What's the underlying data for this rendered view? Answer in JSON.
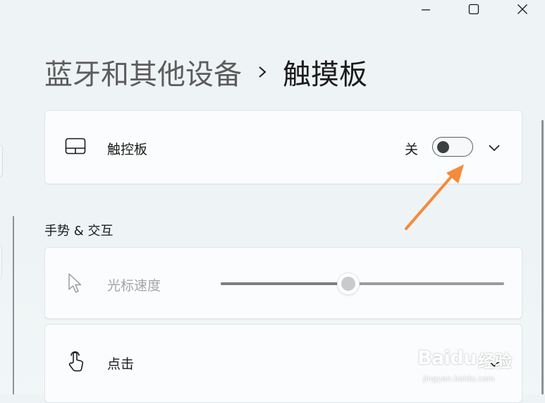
{
  "window": {
    "controls": [
      "minimize-icon",
      "maximize-icon",
      "close-icon"
    ]
  },
  "breadcrumb": {
    "parent": "蓝牙和其他设备",
    "separator_icon": "chevron-right-icon",
    "current": "触摸板"
  },
  "touchpad_card": {
    "icon": "touchpad-icon",
    "label": "触控板",
    "toggle_state_label": "关",
    "toggle_on": false,
    "expand_icon": "chevron-down-icon"
  },
  "gestures_section": {
    "header": "手势 & 交互",
    "cursor_speed": {
      "icon": "pointer-icon",
      "label": "光标速度",
      "value_fraction": 0.45,
      "disabled": true
    },
    "tap": {
      "icon": "tap-hand-icon",
      "label": "点击",
      "expand_icon": "chevron-down-icon"
    }
  },
  "annotation": {
    "arrow_color": "#f58a3a"
  },
  "watermark": {
    "brand": "Baidu",
    "jingyan": "经验",
    "url": "jingyan.baidu.com"
  },
  "colors": {
    "background": "#eef4f6",
    "card": "#fafcfd",
    "toggle_knob": "#3d4043",
    "disabled_text": "#a3a5a7"
  }
}
